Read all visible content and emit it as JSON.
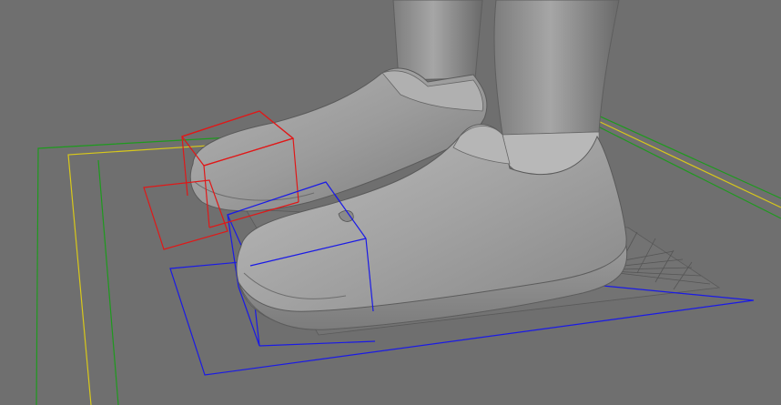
{
  "viewport": {
    "background": "#6f6f6f",
    "colors": {
      "ground_outer": "#1e9a1e",
      "ground_mid": "#d8c81a",
      "left_foot_box": "#e01818",
      "right_foot_box": "#1a1ae6",
      "model_shade": "#9a9a9a",
      "grid_lines": "#4a4a4a"
    },
    "objects": [
      "left-shoe",
      "right-shoe",
      "left-leg",
      "right-leg",
      "floor-grid",
      "ground-plane-outline-green",
      "ground-plane-outline-yellow",
      "left-foot-ik-box-red",
      "right-foot-ik-box-blue"
    ]
  }
}
